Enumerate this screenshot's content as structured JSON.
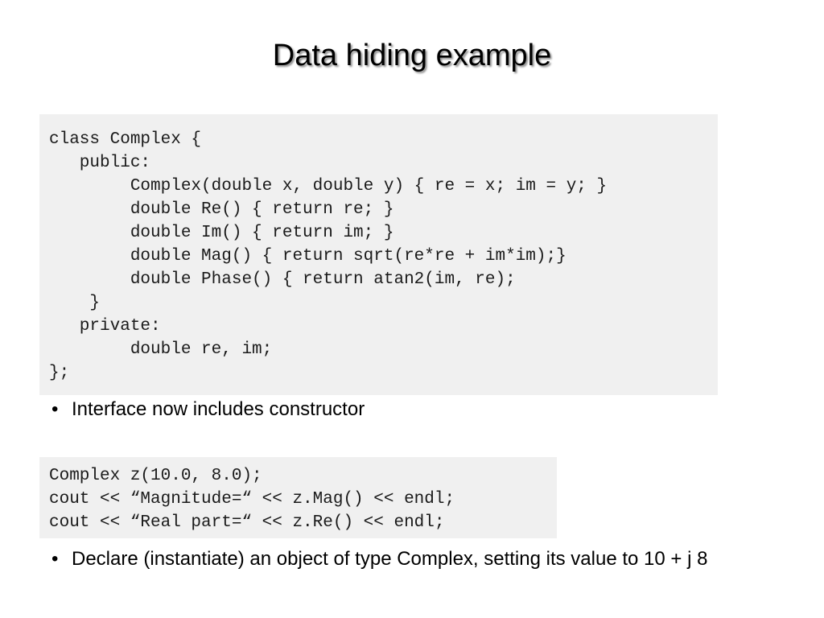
{
  "slide": {
    "title": "Data hiding example"
  },
  "code_block_class": {
    "lines": [
      "class Complex {",
      "   public:",
      "        Complex(double x, double y) { re = x; im = y; }",
      "        double Re() { return re; }",
      "        double Im() { return im; }",
      "        double Mag() { return sqrt(re*re + im*im);}",
      "        double Phase() { return atan2(im, re);",
      "    }",
      "   private:",
      "        double re, im;",
      "};"
    ]
  },
  "code_block_usage": {
    "lines": [
      "Complex z(10.0, 8.0);",
      "cout << “Magnitude=“ << z.Mag() << endl;",
      "cout << “Real part=“ << z.Re() << endl;"
    ]
  },
  "bullets": [
    {
      "marker": "•",
      "text": "Interface now includes constructor"
    },
    {
      "marker": "•",
      "text": "Declare (instantiate) an object of type Complex, setting its value to 10 + j 8"
    }
  ],
  "colors": {
    "page_background": "#ffffff",
    "code_background": "#f0f0f0",
    "text": "#000000",
    "code_text": "#1a1a1a"
  }
}
